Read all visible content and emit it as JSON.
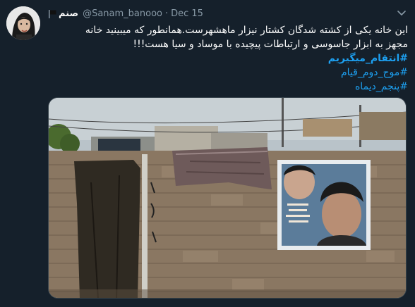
{
  "tweet": {
    "display_name": "صنم",
    "handle": "@Sanam_banooo",
    "separator": "·",
    "date": "Dec 15",
    "text_lines": [
      "این خانه یکی از کشته شدگان کشتار نیزار ماهشهرست.همانطور که میبینید خانه",
      "مجهز به ابزار جاسوسی و ارتباطات پیچیده با موساد و سیا هست!!!"
    ],
    "hashtags": [
      "#انتقام_میگیریم",
      "#موج_دوم_قیام",
      "#پنجم_دیماه"
    ]
  },
  "icons": {
    "avatar": "profile-avatar",
    "flag": "black-flag-icon",
    "menu": "chevron-down-icon"
  },
  "colors": {
    "background": "#15202b",
    "link": "#1da1f2",
    "muted": "#8899a6"
  }
}
